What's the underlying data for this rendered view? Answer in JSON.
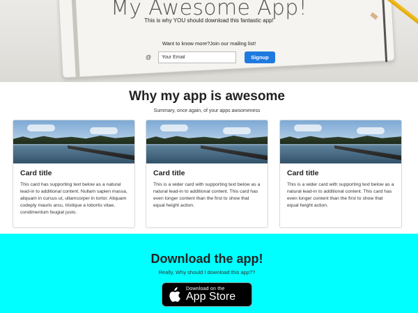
{
  "hero": {
    "title": "My Awesome App!",
    "subtitle": "This is why YOU should download this fantastic app!",
    "mailing_prompt": "Want to know more?Join our mailing list!",
    "at_symbol": "@",
    "email_placeholder": "Your Email",
    "signup_label": "Signup"
  },
  "why": {
    "title": "Why my app is awesome",
    "subtitle": "Summary, once again, of your apps awsomeness"
  },
  "cards": [
    {
      "title": "Card title",
      "text": "This card has supporting text below as a natural lead-in to additional content. Nullam sapien massa, aliquam in cursus ut, ullamcorper in tortor. Aliquam codeply mauris arcu, tristique a lobortis vitae, condimentum feugiat justo."
    },
    {
      "title": "Card title",
      "text": "This is a wider card with supporting text below as a natural lead-in to additional content. This card has even longer content than the first to show that equal height action."
    },
    {
      "title": "Card title",
      "text": "This is a wider card with supporting text below as a natural lead-in to additional content. This card has even longer content than the first to show that equal height action."
    }
  ],
  "download": {
    "title": "Download the app!",
    "subtitle": "Really, Why should I download this app??",
    "badge_small": "Download on the",
    "badge_big": "App Store"
  },
  "colors": {
    "accent": "#1f7ae0",
    "download_bg": "#00ffff"
  }
}
